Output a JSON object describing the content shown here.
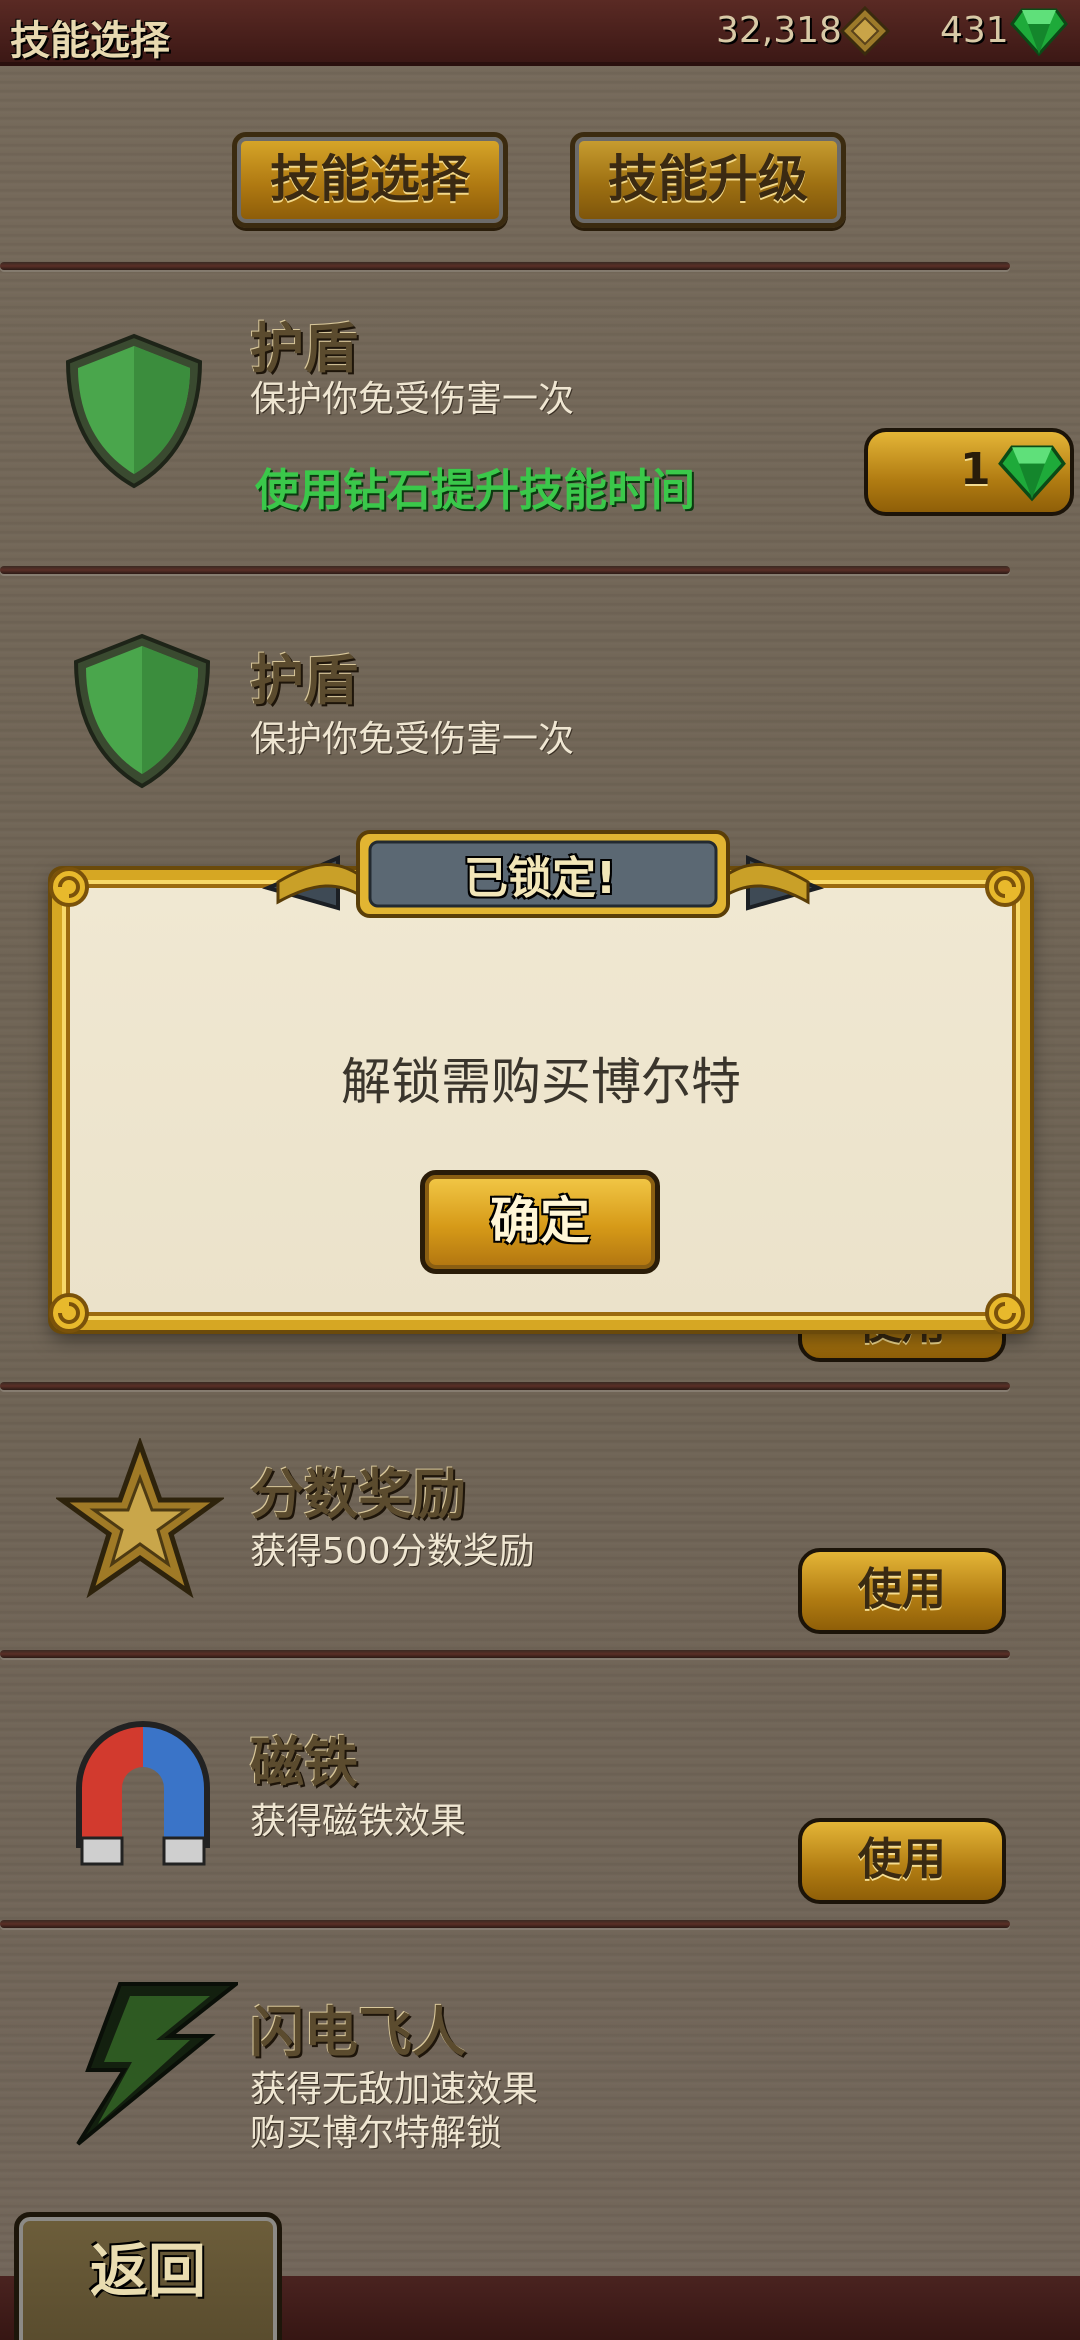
{
  "topbar": {
    "title": "技能选择",
    "coins": "32,318",
    "gems": "431"
  },
  "tabs": [
    {
      "label": "技能选择"
    },
    {
      "label": "技能升级"
    }
  ],
  "skills": [
    {
      "name": "护盾",
      "desc": "保护你免受伤害一次",
      "hint": "使用钻石提升技能时间",
      "cost": "1",
      "icon": "shield-icon"
    },
    {
      "name": "护盾",
      "desc": "保护你免受伤害一次",
      "icon": "shield-icon"
    },
    {
      "name": "分数奖励",
      "desc": "获得500分数奖励",
      "button": "使用",
      "icon": "star-icon"
    },
    {
      "name": "磁铁",
      "desc": "获得磁铁效果",
      "button": "使用",
      "icon": "magnet-icon"
    },
    {
      "name": "闪电飞人",
      "desc_lines": [
        "获得无敌加速效果",
        "购买博尔特解锁"
      ],
      "icon": "lightning-icon"
    }
  ],
  "hidden_use_button": "使用",
  "modal": {
    "title": "已锁定!",
    "message": "解锁需购买博尔特",
    "ok_label": "确定"
  },
  "back_label": "返回",
  "colors": {
    "gold": "#d6a723",
    "wood": "#6f6455",
    "hint_green": "#3ac84a",
    "topbar": "#4a2320"
  }
}
